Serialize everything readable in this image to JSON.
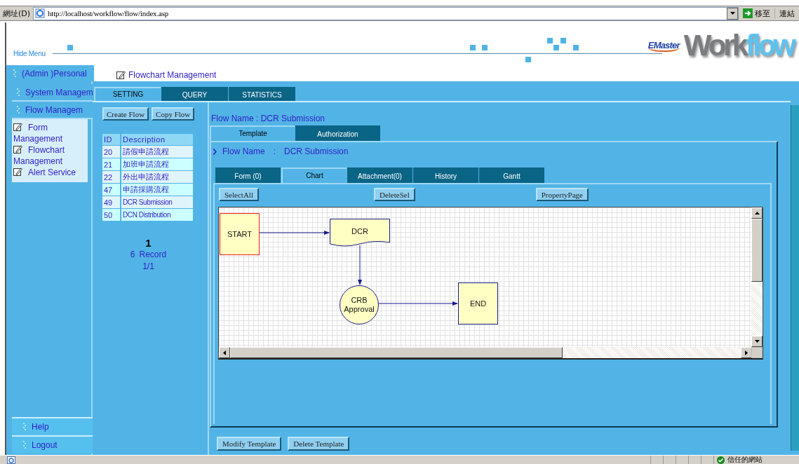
{
  "address_bar": {
    "label": "網址(D)",
    "url": "http://localhost/workflow/flow/index.asp",
    "go": "移至",
    "links": "連結"
  },
  "header": {
    "hide_menu": "Hide Menu",
    "logo": {
      "brand": "EMaster",
      "product": "Work",
      "product_accent": "flow"
    }
  },
  "menu": [
    {
      "label": "(Admin )Personal"
    },
    {
      "label": "System Managem"
    },
    {
      "label": "Flow Managem",
      "children": [
        {
          "label": "Form Management"
        },
        {
          "label": "Flowchart Management"
        },
        {
          "label": "Alert Service"
        }
      ]
    }
  ],
  "menu_bottom": [
    {
      "label": "Help"
    },
    {
      "label": "Logout"
    }
  ],
  "page_title": "Flowchart Management",
  "main_tabs": [
    {
      "label": "SETTING",
      "selected": true
    },
    {
      "label": "QUERY",
      "selected": false
    },
    {
      "label": "STATISTICS",
      "selected": false
    }
  ],
  "flow_buttons": [
    "Create Flow",
    "Copy Flow"
  ],
  "flow_table": {
    "columns": [
      "ID",
      "Description"
    ],
    "rows": [
      [
        "20",
        "請假申請流程"
      ],
      [
        "21",
        "加班申請流程"
      ],
      [
        "22",
        "外出申請流程"
      ],
      [
        "47",
        "申請採購流程"
      ],
      [
        "49",
        "DCR Submission"
      ],
      [
        "50",
        "DCN Distribution"
      ]
    ]
  },
  "pager": {
    "page": "1",
    "count": "6",
    "unit": "Record",
    "pages": "1/1"
  },
  "flow_name": "Flow Name : DCR Submission",
  "sub_tabs": [
    {
      "label": "Template",
      "selected": true
    },
    {
      "label": "Authorization",
      "selected": false
    }
  ],
  "flow_name_line": {
    "label": "Flow Name",
    "separator": ":",
    "value": "DCR Submission"
  },
  "detail_tabs": [
    {
      "label": "Form (0)",
      "selected": false
    },
    {
      "label": "Chart",
      "selected": true
    },
    {
      "label": "Attachment(0)",
      "selected": false
    },
    {
      "label": "History",
      "selected": false
    },
    {
      "label": "Gantt",
      "selected": false
    }
  ],
  "chart_toolbar": [
    "SelectAll",
    "DeleteSel",
    "PropertyPage"
  ],
  "flowchart": {
    "nodes": [
      {
        "kind": "start",
        "label": "START"
      },
      {
        "kind": "document",
        "label": "DCR"
      },
      {
        "kind": "approval",
        "label": "CRB Approval"
      },
      {
        "kind": "end",
        "label": "END"
      }
    ]
  },
  "template_buttons": [
    "Modify Template",
    "Delete Template"
  ],
  "status_bar": {
    "zone": "信任的網站"
  }
}
